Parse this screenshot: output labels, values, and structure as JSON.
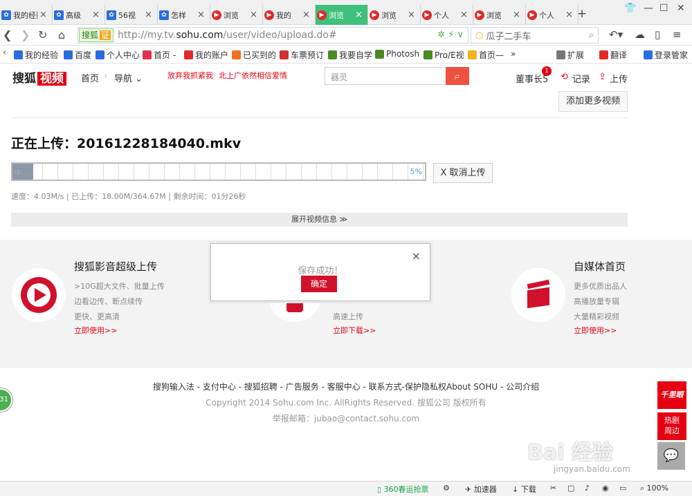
{
  "tabs": [
    {
      "title": "我的经验",
      "icon": "paw-icon",
      "color": "#2b6de0"
    },
    {
      "title": "高级",
      "icon": "paw-icon",
      "color": "#2b6de0"
    },
    {
      "title": "56视",
      "icon": "paw-icon",
      "color": "#2b6de0"
    },
    {
      "title": "怎样",
      "icon": "paw-icon",
      "color": "#2b6de0"
    },
    {
      "title": "浏览",
      "icon": "play-icon",
      "color": "#e02a2a"
    },
    {
      "title": "我的",
      "icon": "play-icon",
      "color": "#e02a2a"
    },
    {
      "title": "浏览",
      "icon": "play-icon",
      "color": "#e02a2a",
      "active": true
    },
    {
      "title": "浏览",
      "icon": "play-icon",
      "color": "#e02a2a"
    },
    {
      "title": "个人",
      "icon": "play-icon",
      "color": "#e02a2a"
    },
    {
      "title": "浏览",
      "icon": "play-icon",
      "color": "#e02a2a"
    },
    {
      "title": "个人",
      "icon": "play-icon",
      "color": "#e02a2a"
    }
  ],
  "address": {
    "cert_label": "搜狐",
    "cert_badge": "证",
    "url_prefix": "http://my.tv.",
    "url_domain": "sohu.com",
    "url_suffix": "/user/video/upload.do#",
    "search_text": "瓜子二手车"
  },
  "bookmarks": [
    "我的经验",
    "百度",
    "个人中心",
    "首页 -",
    "我的账户",
    "已买到的",
    "车票预订",
    "我要自学",
    "Photosh",
    "Pro/E视",
    "首页—",
    "»",
    "扩展",
    "翻译",
    "登录管家"
  ],
  "site": {
    "logo": "搜狐",
    "logo_tag": "视频",
    "nav_home": "首页",
    "nav_guide": "导航",
    "promo1": "放弃我抓紧我",
    "promo2": "北上广依然相信爱情",
    "search_placeholder": "器灵",
    "user": "董事长5",
    "badge": "1",
    "record": "记录",
    "upload": "上传",
    "add_more": "添加更多视频"
  },
  "upload": {
    "title": "正在上传：20161228184040.mkv",
    "progress_percent": 5,
    "progress_label": "中...",
    "pct_text": "5%",
    "cancel": "X 取消上传",
    "speed_line": "速度：4.03M/s | 已上传：18.00M/364.67M | 剩余时间：01分26秒",
    "expand": "展开视频信息 ≫"
  },
  "promos": [
    {
      "title": "搜狐影音超级上传",
      "lines": [
        ">10G超大文件、批量上传",
        "边看边传、断点续传",
        "更快、更高清"
      ],
      "link": "立即使用>>"
    },
    {
      "title": "",
      "lines": [
        "高速上传"
      ],
      "link": "立即下载>>"
    },
    {
      "title": "自媒体首页",
      "lines": [
        "更多优质出品人",
        "高播放量专辑",
        "大量精彩视频"
      ],
      "link": "立即使用>>"
    }
  ],
  "footer": {
    "links": "搜狗输入法 - 支付中心 - 搜狐招聘 - 广告服务 - 客服中心 - 联系方式-保护隐私权About SOHU - 公司介绍",
    "copyright": "Copyright   2014 Sohu.com Inc. AllRights Reserved. 搜狐公司 版权所有",
    "report": "举报邮箱：jubao@contact.sohu.com"
  },
  "side_ads": [
    "千里眼",
    "热剧周边"
  ],
  "modal": {
    "message": "保存成功！",
    "ok": "确定",
    "close": "×"
  },
  "statusbar": {
    "promo": "360春运抢票",
    "accel": "加速器",
    "download": "下载",
    "zoom": "100%"
  },
  "left_badge": "31",
  "watermark": "Bai 经验",
  "watermark2": "jingyan.baidu.com"
}
